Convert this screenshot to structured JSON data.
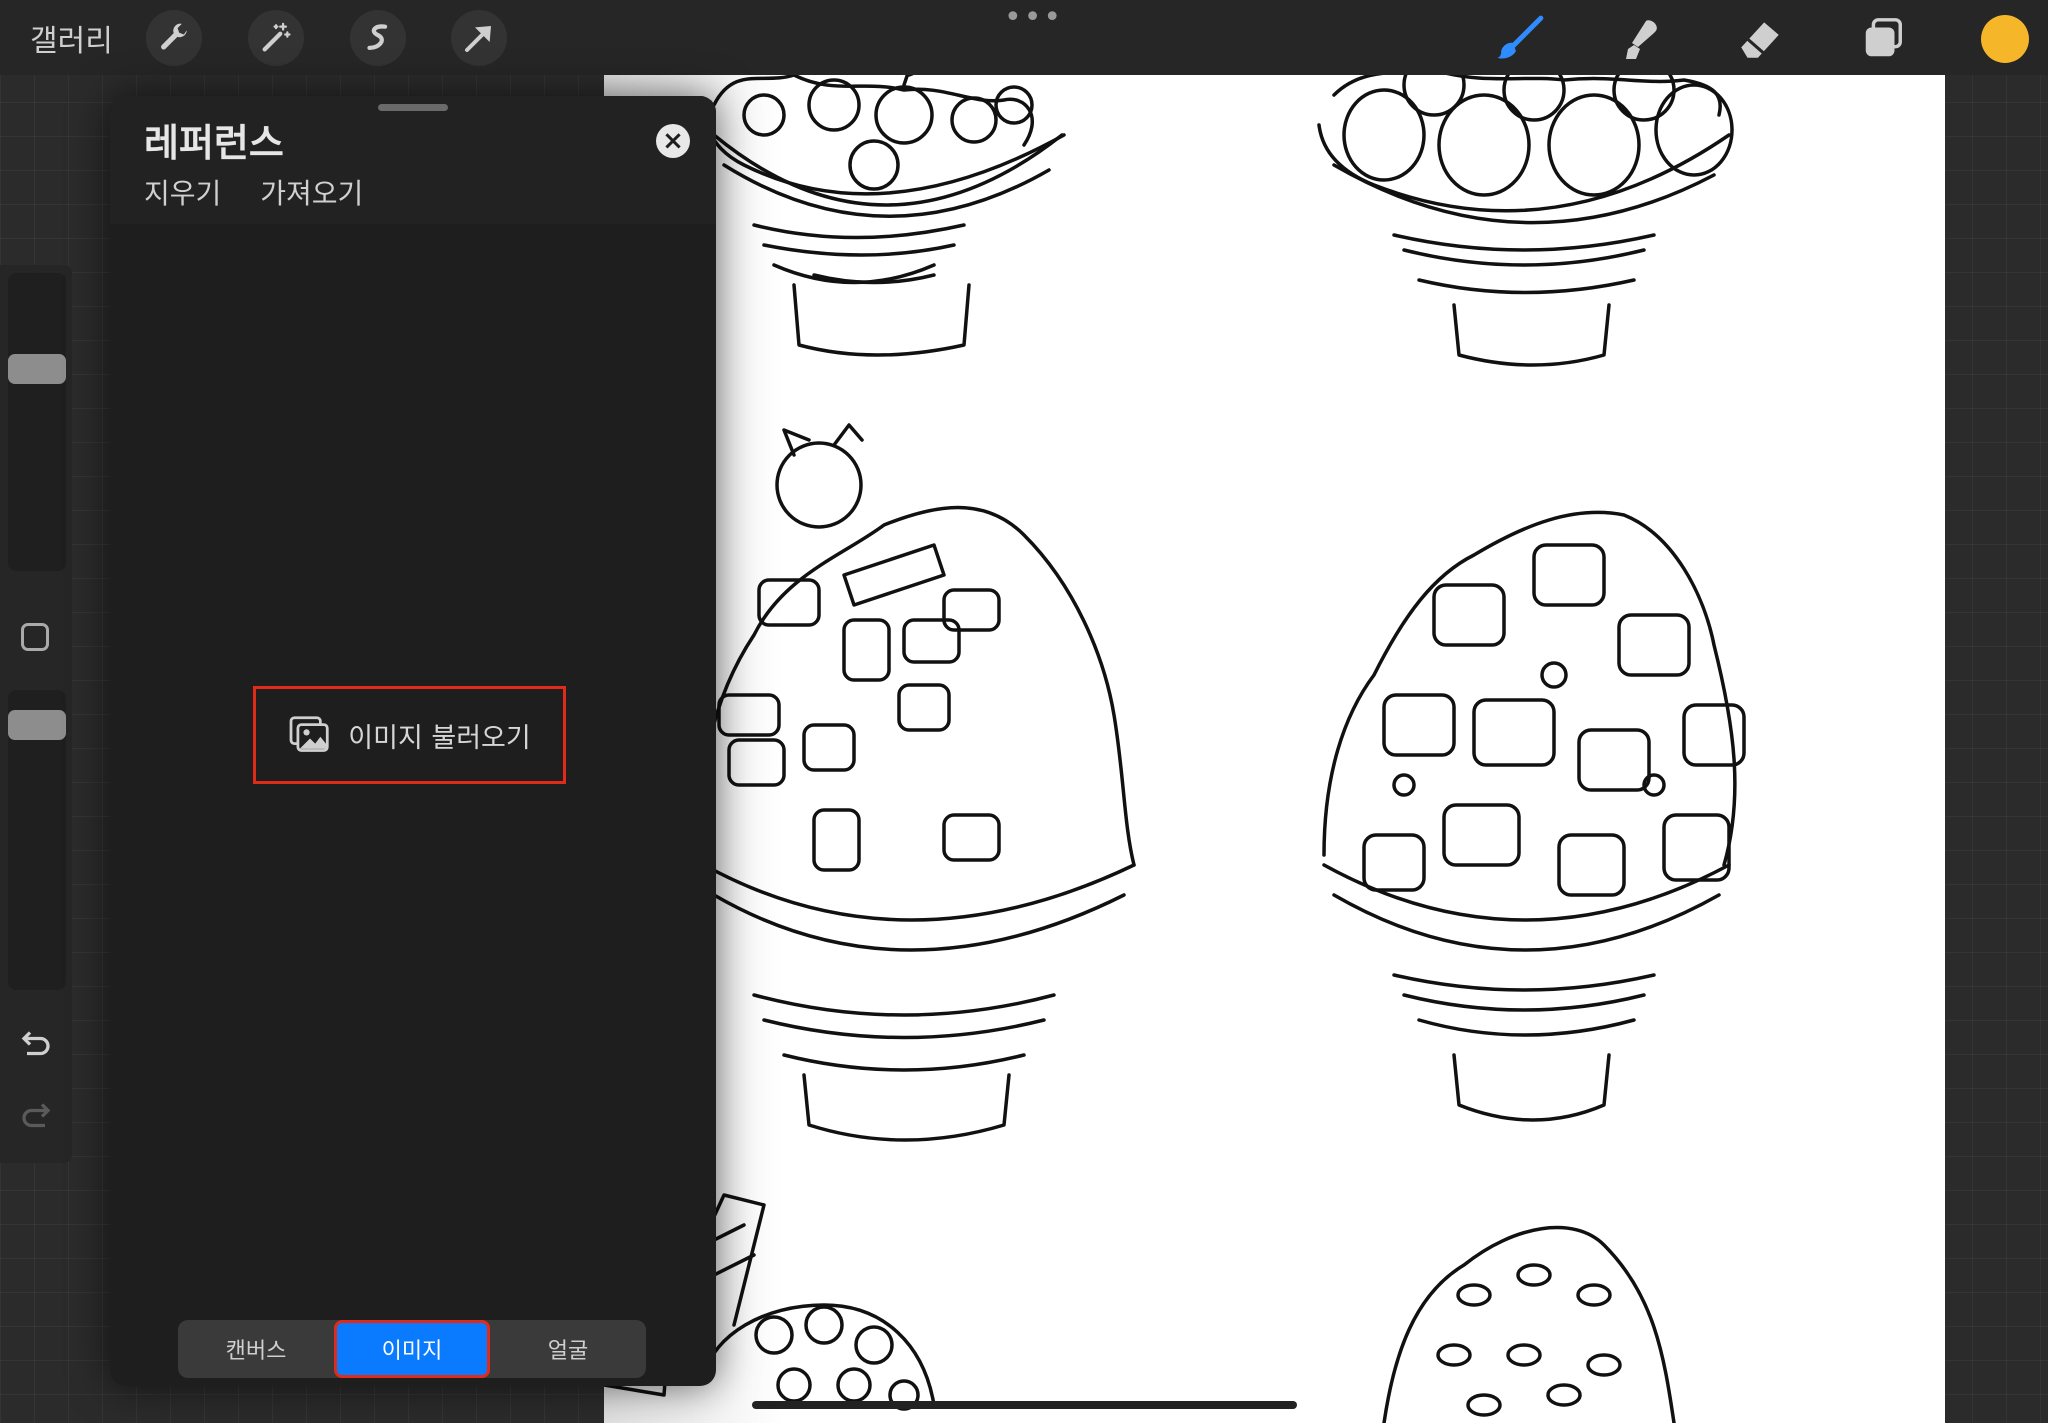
{
  "topbar": {
    "gallery_label": "갤러리",
    "dots": "•••",
    "tools_left": [
      "wrench-icon",
      "magic-wand-icon",
      "selection-icon",
      "transform-arrow-icon"
    ],
    "tools_right": [
      "brush-icon",
      "smudge-icon",
      "eraser-icon",
      "layers-icon"
    ],
    "active_color": "#f5b62a",
    "brush_accent": "#2f8cff"
  },
  "reference_panel": {
    "title": "레퍼런스",
    "actions": {
      "clear": "지우기",
      "import": "가져오기"
    },
    "import_image_label": "이미지 불러오기",
    "segments": [
      "캔버스",
      "이미지",
      "얼굴"
    ],
    "selected_segment": "이미지"
  },
  "highlight_color": "#e02a1a"
}
